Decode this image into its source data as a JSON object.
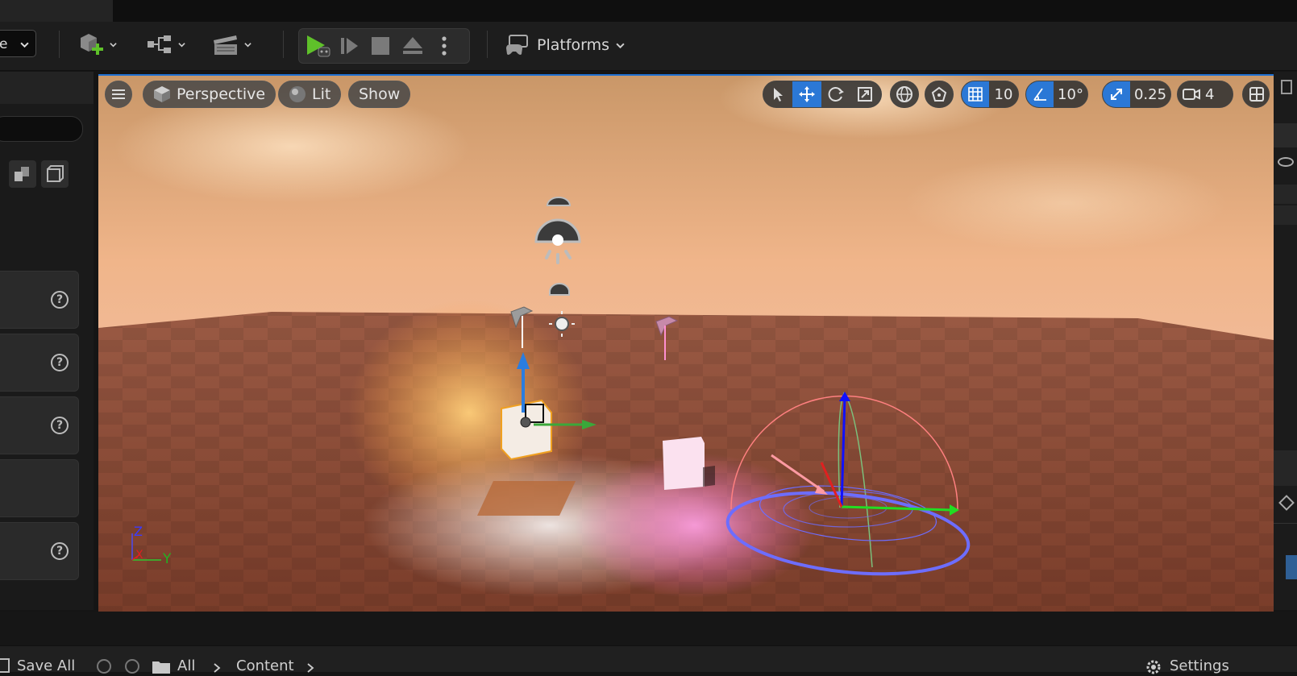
{
  "toolbar": {
    "mode_select_label": "e",
    "platforms_label": "Platforms"
  },
  "viewport": {
    "perspective_label": "Perspective",
    "lit_label": "Lit",
    "show_label": "Show",
    "grid_snap_value": "10",
    "rotation_snap_value": "10°",
    "scale_snap_value": "0.25",
    "camera_speed_value": "4",
    "axis_labels": {
      "z": "Z",
      "x": "X",
      "y": "Y"
    }
  },
  "bottom_bar": {
    "save_all_label": "Save All",
    "breadcrumb_all": "All",
    "breadcrumb_content": "Content",
    "settings_label": "Settings"
  },
  "colors": {
    "accent_blue": "#2b78d6",
    "play_green": "#5fc12a",
    "gizmo_x": "#e02020",
    "gizmo_y": "#2ec82e",
    "gizmo_z": "#2255ff",
    "light_radius": "#6d6dff"
  },
  "icons": [
    "add-actor-icon",
    "blueprint-icon",
    "cinematics-icon",
    "play-icon",
    "advance-frame-icon",
    "stop-icon",
    "eject-icon",
    "more-icon",
    "platforms-icon",
    "viewport-menu-icon",
    "cube-icon",
    "lit-sphere-icon",
    "select-icon",
    "translate-icon",
    "rotate-icon",
    "scale-icon",
    "world-icon",
    "surface-snap-icon",
    "grid-icon",
    "angle-icon",
    "scale-snap-icon",
    "camera-icon",
    "maximize-icon",
    "help-icon",
    "save-icon",
    "back-icon",
    "forward-icon",
    "folder-icon",
    "gear-icon"
  ]
}
